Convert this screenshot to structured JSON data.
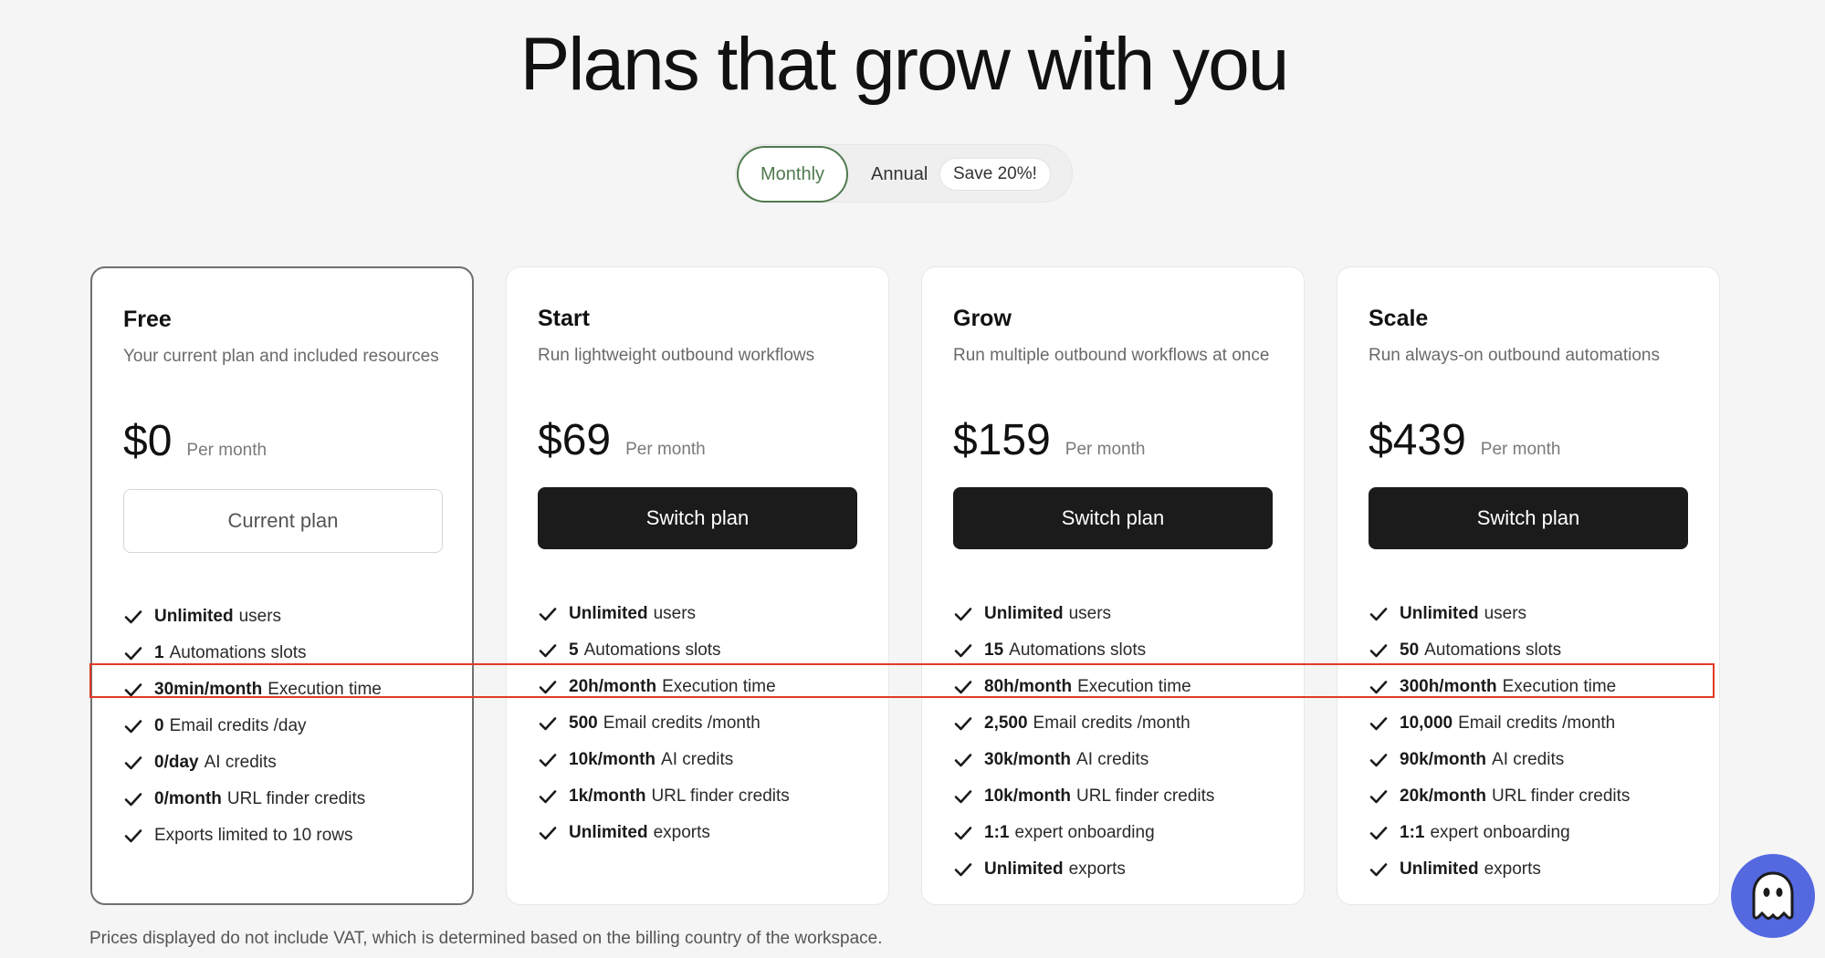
{
  "title": "Plans that grow with you",
  "billing_toggle": {
    "monthly": "Monthly",
    "annual": "Annual",
    "save_badge": "Save 20%!"
  },
  "plans": [
    {
      "name": "Free",
      "description": "Your current plan and included resources",
      "price": "$0",
      "period": "Per month",
      "button": "Current plan",
      "features": [
        {
          "strong": "Unlimited",
          "text": "users"
        },
        {
          "strong": "1",
          "text": "Automations slots"
        },
        {
          "strong": "30min/month",
          "text": "Execution time"
        },
        {
          "strong": "0",
          "text": "Email credits /day"
        },
        {
          "strong": "0/day",
          "text": "AI credits"
        },
        {
          "strong": "0/month",
          "text": "URL finder credits"
        },
        {
          "strong": "",
          "text": "Exports limited to 10 rows"
        }
      ]
    },
    {
      "name": "Start",
      "description": "Run lightweight outbound workflows",
      "price": "$69",
      "period": "Per month",
      "button": "Switch plan",
      "features": [
        {
          "strong": "Unlimited",
          "text": "users"
        },
        {
          "strong": "5",
          "text": "Automations slots"
        },
        {
          "strong": "20h/month",
          "text": "Execution time"
        },
        {
          "strong": "500",
          "text": "Email credits /month"
        },
        {
          "strong": "10k/month",
          "text": "AI credits"
        },
        {
          "strong": "1k/month",
          "text": "URL finder credits"
        },
        {
          "strong": "Unlimited",
          "text": "exports"
        }
      ]
    },
    {
      "name": "Grow",
      "description": "Run multiple outbound workflows at once",
      "price": "$159",
      "period": "Per month",
      "button": "Switch plan",
      "features": [
        {
          "strong": "Unlimited",
          "text": "users"
        },
        {
          "strong": "15",
          "text": "Automations slots"
        },
        {
          "strong": "80h/month",
          "text": "Execution time"
        },
        {
          "strong": "2,500",
          "text": "Email credits /month"
        },
        {
          "strong": "30k/month",
          "text": "AI credits"
        },
        {
          "strong": "10k/month",
          "text": "URL finder credits"
        },
        {
          "strong": "1:1",
          "text": "expert onboarding"
        },
        {
          "strong": "Unlimited",
          "text": "exports"
        }
      ]
    },
    {
      "name": "Scale",
      "description": "Run always-on outbound automations",
      "price": "$439",
      "period": "Per month",
      "button": "Switch plan",
      "features": [
        {
          "strong": "Unlimited",
          "text": "users"
        },
        {
          "strong": "50",
          "text": "Automations slots"
        },
        {
          "strong": "300h/month",
          "text": "Execution time"
        },
        {
          "strong": "10,000",
          "text": "Email credits /month"
        },
        {
          "strong": "90k/month",
          "text": "AI credits"
        },
        {
          "strong": "20k/month",
          "text": "URL finder credits"
        },
        {
          "strong": "1:1",
          "text": "expert onboarding"
        },
        {
          "strong": "Unlimited",
          "text": "exports"
        }
      ]
    }
  ],
  "footnote": "Prices displayed do not include VAT, which is determined based on the billing country of the workspace.",
  "icons": {
    "check": "check-icon",
    "chat": "ghost-chat-icon"
  },
  "colors": {
    "accent_green": "#4e7a4e",
    "highlight_red": "#e13b26",
    "button_dark": "#1b1b1b",
    "chat_blue": "#5468e0"
  }
}
